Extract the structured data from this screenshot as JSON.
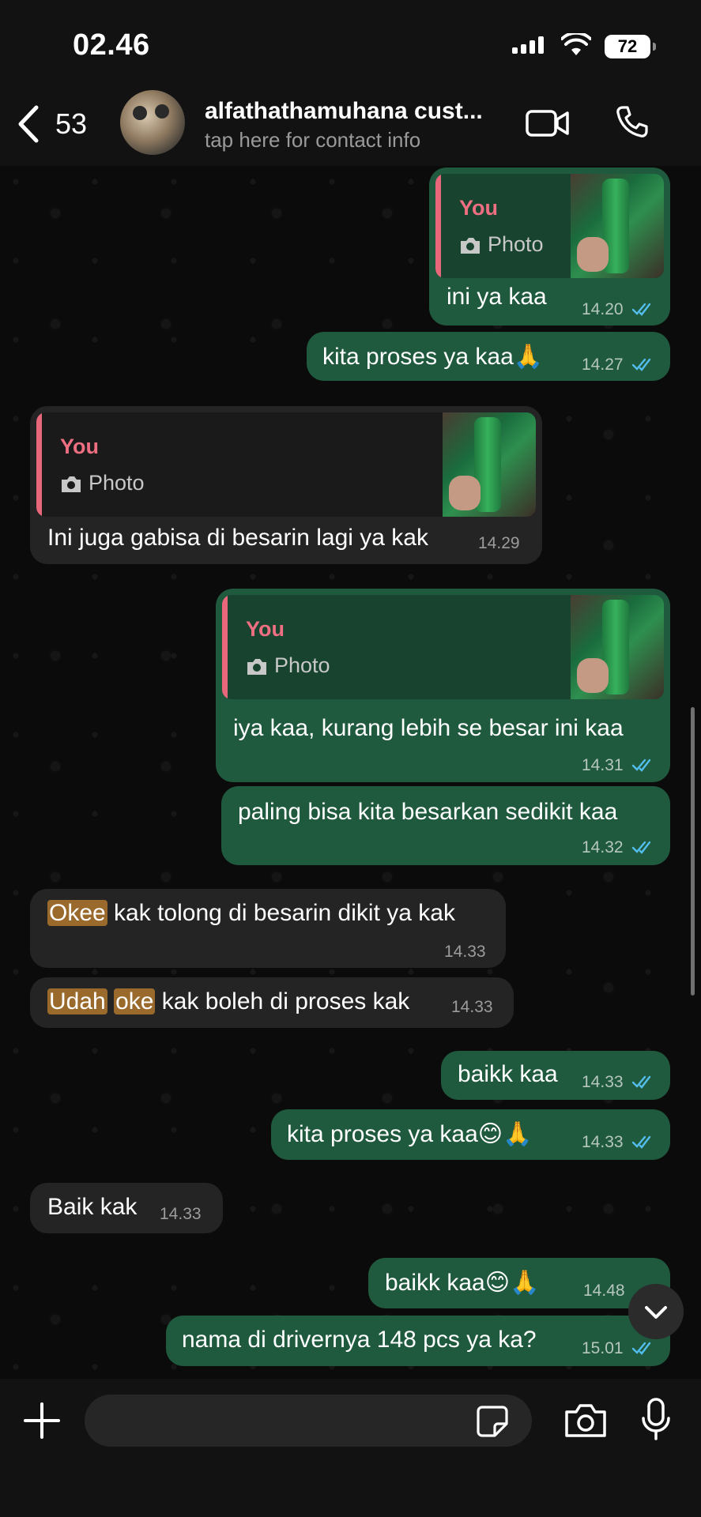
{
  "status_bar": {
    "time": "02.46",
    "battery": "72"
  },
  "header": {
    "back_count": "53",
    "contact_name": "alfathathamuhana cust...",
    "contact_subtitle": "tap here for contact info",
    "icons": [
      "chevron-left-icon",
      "video-call-icon",
      "phone-icon"
    ]
  },
  "messages": [
    {
      "direction": "out",
      "quote": {
        "author": "You",
        "type": "Photo"
      },
      "text": "ini ya kaa",
      "time": "14.20",
      "read": true
    },
    {
      "direction": "out",
      "text": "kita proses ya kaa🙏",
      "time": "14.27",
      "read": true
    },
    {
      "direction": "in",
      "quote": {
        "author": "You",
        "type": "Photo"
      },
      "text": "Ini juga gabisa di besarin lagi ya kak",
      "time": "14.29"
    },
    {
      "direction": "out",
      "quote": {
        "author": "You",
        "type": "Photo"
      },
      "text": "iya kaa, kurang lebih se besar ini kaa",
      "time": "14.31",
      "read": true
    },
    {
      "direction": "out",
      "text": "paling bisa kita besarkan sedikit kaa",
      "time": "14.32",
      "read": true
    },
    {
      "direction": "in",
      "highlight": "Okee",
      "text": " kak tolong di besarin dikit ya kak",
      "time": "14.33"
    },
    {
      "direction": "in",
      "highlight": "Udah",
      "highlight2": "oke",
      "text": " kak boleh di proses kak",
      "time": "14.33"
    },
    {
      "direction": "out",
      "text": "baikk kaa",
      "time": "14.33",
      "read": true
    },
    {
      "direction": "out",
      "text": "kita proses ya kaa😊🙏",
      "time": "14.33",
      "read": true
    },
    {
      "direction": "in",
      "text": "Baik kak",
      "time": "14.33"
    },
    {
      "direction": "out",
      "text": "baikk kaa😊🙏",
      "time": "14.48",
      "read": true
    },
    {
      "direction": "out",
      "text": "nama di drivernya 148 pcs ya ka?",
      "time": "15.01",
      "read": true
    }
  ],
  "composer": {
    "value": ""
  },
  "colors": {
    "outgoing_bubble": "#1f5a3e",
    "incoming_bubble": "#242424",
    "quote_accent": "#e8677a",
    "read_ticks": "#53bdeb",
    "highlight": "#9a6a2c"
  }
}
